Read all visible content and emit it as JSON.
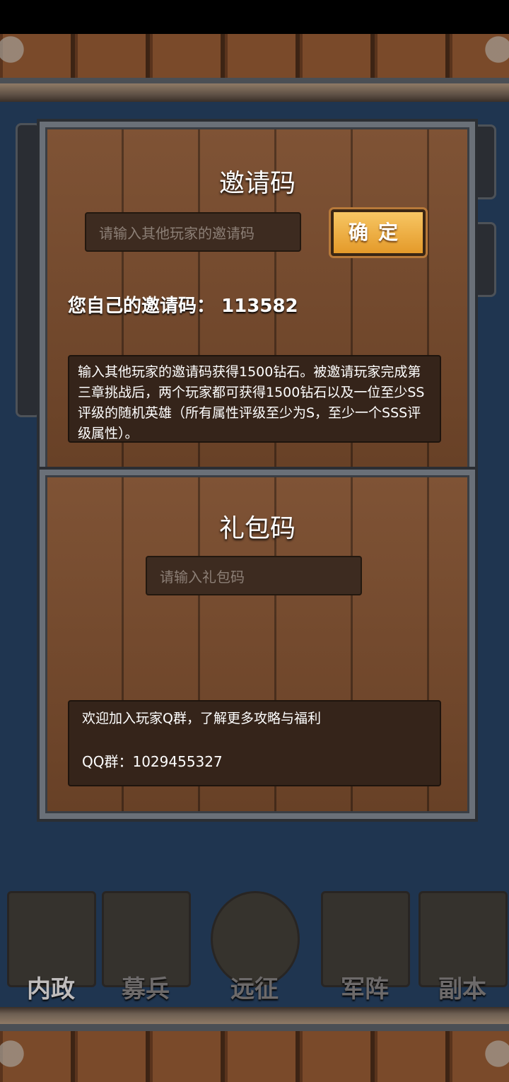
{
  "invite": {
    "title": "邀请码",
    "input_placeholder": "请输入其他玩家的邀请码",
    "confirm_label": "确定",
    "own_code_label": "您自己的邀请码：",
    "own_code_value": "113582",
    "description": "输入其他玩家的邀请码获得1500钻石。被邀请玩家完成第三章挑战后，两个玩家都可获得1500钻石以及一位至少SS评级的随机英雄（所有属性评级至少为S，至少一个SSS评级属性）。"
  },
  "gift": {
    "title": "礼包码",
    "input_placeholder": "请输入礼包码",
    "community_text": "欢迎加入玩家Q群，了解更多攻略与福利",
    "qq_label": "QQ群：",
    "qq_value": "1029455327"
  },
  "nav": {
    "items": [
      {
        "label": "内政",
        "icon": "scroll-seal-icon"
      },
      {
        "label": "募兵",
        "icon": "knight-helmets-icon"
      },
      {
        "label": "远征",
        "icon": "sword-emblem-icon"
      },
      {
        "label": "军阵",
        "icon": "chess-pieces-icon"
      },
      {
        "label": "副本",
        "icon": "flame-totem-icon"
      }
    ]
  }
}
